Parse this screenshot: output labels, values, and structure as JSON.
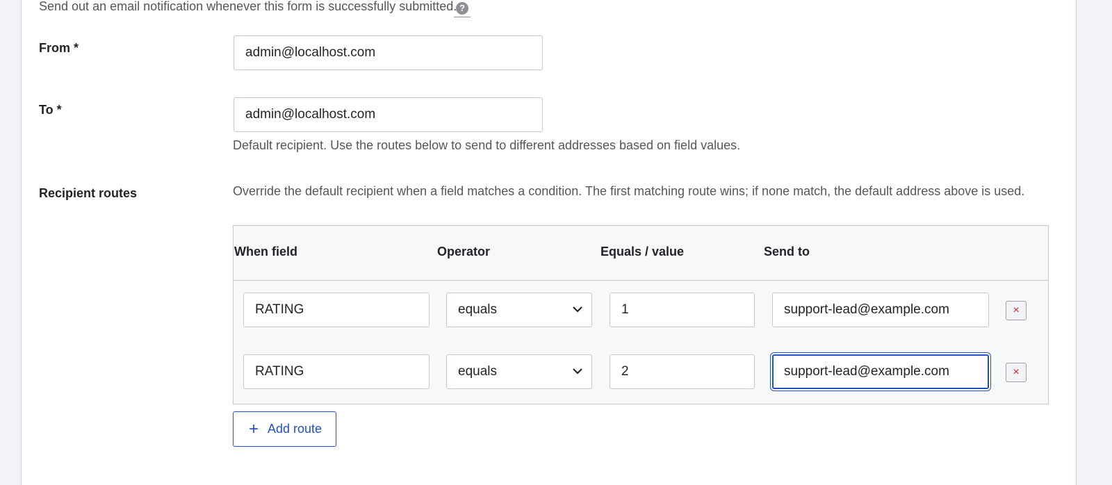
{
  "notification": {
    "description": "Send out an email notification whenever this form is successfully submitted.",
    "help_icon": "?"
  },
  "from": {
    "label": "From *",
    "value": "admin@localhost.com"
  },
  "to": {
    "label": "To *",
    "value": "admin@localhost.com",
    "description": "Default recipient. Use the routes below to send to different addresses based on field values."
  },
  "routes": {
    "label": "Recipient routes",
    "description": "Override the default recipient when a field matches a condition. The first matching route wins; if none match, the default address above is used.",
    "headers": {
      "when_field": "When field",
      "operator": "Operator",
      "value": "Equals / value",
      "send_to": "Send to"
    },
    "rows": [
      {
        "field": "RATING",
        "operator": "equals",
        "value": "1",
        "send_to": "support-lead@example.com",
        "remove": "×"
      },
      {
        "field": "RATING",
        "operator": "equals",
        "value": "2",
        "send_to": "support-lead@example.com",
        "remove": "×"
      }
    ],
    "add_plus": "+",
    "add_label": "Add route"
  },
  "colors": {
    "accent": "#2150c8",
    "danger": "#d2202f"
  }
}
